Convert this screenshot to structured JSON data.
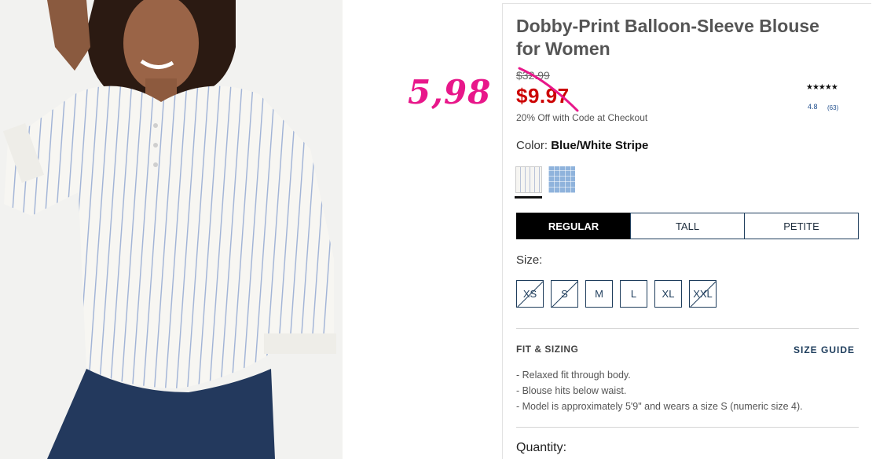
{
  "annotation": {
    "handwritten_price": "5,98",
    "color": "#e8178a"
  },
  "product": {
    "title": "Dobby-Print Balloon-Sleeve Blouse for Women",
    "original_price": "$32.99",
    "sale_price": "$9.97",
    "promo": "20% Off with Code at Checkout",
    "rating": {
      "stars": "★★★★★",
      "value": "4.8",
      "count": "(63)"
    }
  },
  "color": {
    "label": "Color:",
    "value": "Blue/White Stripe",
    "swatches": [
      "blue-white-stripe",
      "light-blue-check"
    ]
  },
  "fit_tabs": [
    {
      "label": "REGULAR",
      "active": true
    },
    {
      "label": "TALL",
      "active": false
    },
    {
      "label": "PETITE",
      "active": false
    }
  ],
  "size": {
    "label": "Size:",
    "options": [
      {
        "label": "XS",
        "available": false
      },
      {
        "label": "S",
        "available": false
      },
      {
        "label": "M",
        "available": true
      },
      {
        "label": "L",
        "available": true
      },
      {
        "label": "XL",
        "available": true
      },
      {
        "label": "XXL",
        "available": false
      }
    ]
  },
  "fit_sizing": {
    "title": "FIT & SIZING",
    "guide_link": "SIZE GUIDE",
    "bullets": [
      "Relaxed fit through body.",
      "Blouse hits below waist.",
      "Model is approximately 5'9\" and wears a size S (numeric size 4)."
    ]
  },
  "quantity": {
    "label": "Quantity:"
  }
}
